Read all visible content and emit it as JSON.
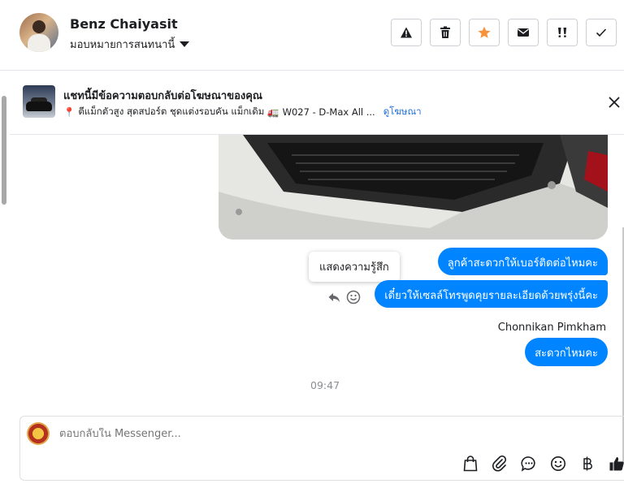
{
  "header": {
    "contact_name": "Benz Chaiyasit",
    "assign_label": "มอบหมายการสนทนานี้",
    "actions": [
      "warning-icon",
      "trash-icon",
      "star-icon",
      "mail-icon",
      "important-icon",
      "check-icon"
    ],
    "star_color": "#f7923a"
  },
  "ad": {
    "title": "แชทนี้มีข้อความตอบกลับต่อโฆษณาของคุณ",
    "pin_emoji": "📍",
    "description_1": "ตีแม็กตัวสูง สุดสปอร์ต ชุดแต่งรอบคัน แม็กเดิม",
    "truck_emoji": "🚛",
    "description_2": "W027 - D-Max All ...",
    "link_label": "ดูโฆษณา"
  },
  "messages": {
    "bubble_1": "ลูกค้าสะดวกให้เบอร์ติดต่อไหมคะ",
    "bubble_2": "เดี๋ยวให้เซลล์โทรพูดคุยรายละเอียดด้วยพรุ่งนี้คะ",
    "tooltip": "แสดงความรู้สึก",
    "sender_name": "Chonnikan Pimkham",
    "bubble_3": "สะดวกไหมคะ",
    "timestamp": "09:47",
    "bubble_color": "#0084ff"
  },
  "composer": {
    "placeholder": "ตอบกลับใน Messenger...",
    "tools": [
      "shopping-bag-icon",
      "paperclip-icon",
      "chat-bubble-icon",
      "emoji-icon",
      "baht-icon",
      "thumbs-up-icon"
    ]
  }
}
